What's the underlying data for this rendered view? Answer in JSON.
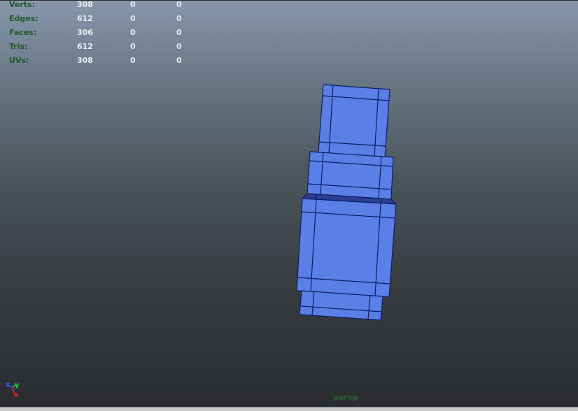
{
  "heads_up": {
    "rows": [
      {
        "label": "Verts:",
        "values": [
          "308",
          "0",
          "0"
        ]
      },
      {
        "label": "Edges:",
        "values": [
          "612",
          "0",
          "0"
        ]
      },
      {
        "label": "Faces:",
        "values": [
          "306",
          "0",
          "0"
        ]
      },
      {
        "label": "Tris:",
        "values": [
          "612",
          "0",
          "0"
        ]
      },
      {
        "label": "UVs:",
        "values": [
          "308",
          "0",
          "0"
        ]
      }
    ]
  },
  "axis_indicator": {
    "z": "z",
    "y": "y",
    "x": "x"
  },
  "camera": {
    "name": "persp"
  },
  "colors": {
    "mesh_fill": "#5a7fe6",
    "mesh_edge": "#0d1e66",
    "label_green": "#1f5a2a",
    "value_white": "#e8ecef"
  }
}
